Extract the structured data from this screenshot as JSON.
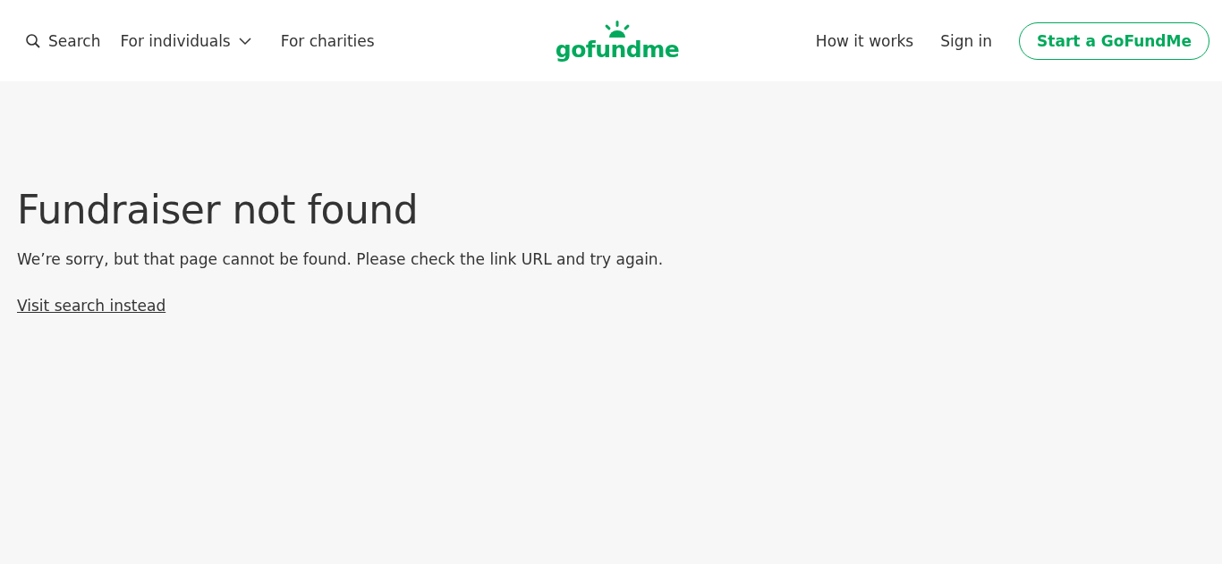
{
  "header": {
    "search": "Search",
    "nav_left": [
      {
        "label": "For individuals",
        "kind": "dropdown"
      },
      {
        "label": "For charities",
        "kind": "link"
      }
    ],
    "logo": "gofundme",
    "nav_right": [
      "How it works",
      "Sign in"
    ],
    "cta": "Start a GoFundMe"
  },
  "main": {
    "title": "Fundraiser not found",
    "message": "We’re sorry, but that page cannot be found. Please check the link URL and try again.",
    "link": "Visit search instead"
  }
}
